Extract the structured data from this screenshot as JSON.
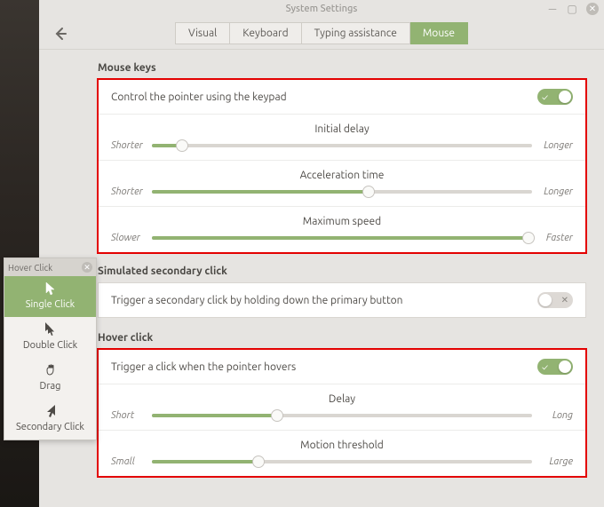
{
  "window": {
    "title": "System Settings"
  },
  "tabs": {
    "visual": "Visual",
    "keyboard": "Keyboard",
    "typing": "Typing assistance",
    "mouse": "Mouse"
  },
  "mouseKeys": {
    "title": "Mouse keys",
    "control": "Control the pointer using the keypad",
    "initial": {
      "label": "Initial delay",
      "lo": "Shorter",
      "hi": "Longer",
      "pct": 8
    },
    "accel": {
      "label": "Acceleration time",
      "lo": "Shorter",
      "hi": "Longer",
      "pct": 57
    },
    "max": {
      "label": "Maximum speed",
      "lo": "Slower",
      "hi": "Faster",
      "pct": 99
    }
  },
  "secondary": {
    "title": "Simulated secondary click",
    "trigger": "Trigger a secondary click by holding down the primary button"
  },
  "hover": {
    "title": "Hover click",
    "trigger": "Trigger a click when the pointer hovers",
    "delay": {
      "label": "Delay",
      "lo": "Short",
      "hi": "Long",
      "pct": 33
    },
    "thresh": {
      "label": "Motion threshold",
      "lo": "Small",
      "hi": "Large",
      "pct": 28
    }
  },
  "palette": {
    "title": "Hover Click",
    "single": "Single Click",
    "double": "Double Click",
    "drag": "Drag",
    "secondary": "Secondary Click"
  },
  "toggle": {
    "on": "✓",
    "off": "✕"
  }
}
